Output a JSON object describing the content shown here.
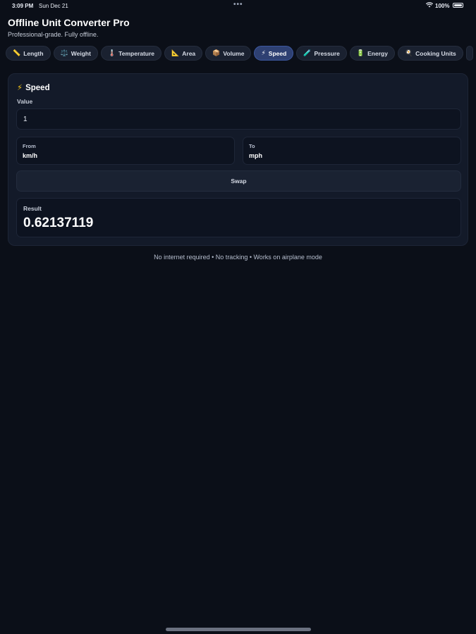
{
  "status_bar": {
    "time": "3:09 PM",
    "date": "Sun Dec 21",
    "dots": "•••",
    "wifi_icon": "wifi-icon",
    "battery": "100%"
  },
  "header": {
    "title": "Offline Unit Converter Pro",
    "subtitle": "Professional-grade. Fully offline."
  },
  "tabs": [
    {
      "icon": "📏",
      "label": "Length"
    },
    {
      "icon": "⚖️",
      "label": "Weight"
    },
    {
      "icon": "🌡️",
      "label": "Temperature"
    },
    {
      "icon": "📐",
      "label": "Area"
    },
    {
      "icon": "📦",
      "label": "Volume"
    },
    {
      "icon": "⚡",
      "label": "Speed",
      "active": true
    },
    {
      "icon": "🧪",
      "label": "Pressure"
    },
    {
      "icon": "🔋",
      "label": "Energy"
    },
    {
      "icon": "🍳",
      "label": "Cooking Units"
    }
  ],
  "converter": {
    "icon": "⚡",
    "title": "Speed",
    "value_label": "Value",
    "value": "1",
    "from_label": "From",
    "from_unit": "km/h",
    "to_label": "To",
    "to_unit": "mph",
    "swap_label": "Swap",
    "result_label": "Result",
    "result_value": "0.62137119"
  },
  "footer": {
    "text": "No internet required • No tracking • Works on airplane mode"
  },
  "colors": {
    "background": "#0b0f18",
    "card": "#131a29",
    "active_tab": "#2e4072",
    "accent_icon": "#f5c518"
  }
}
